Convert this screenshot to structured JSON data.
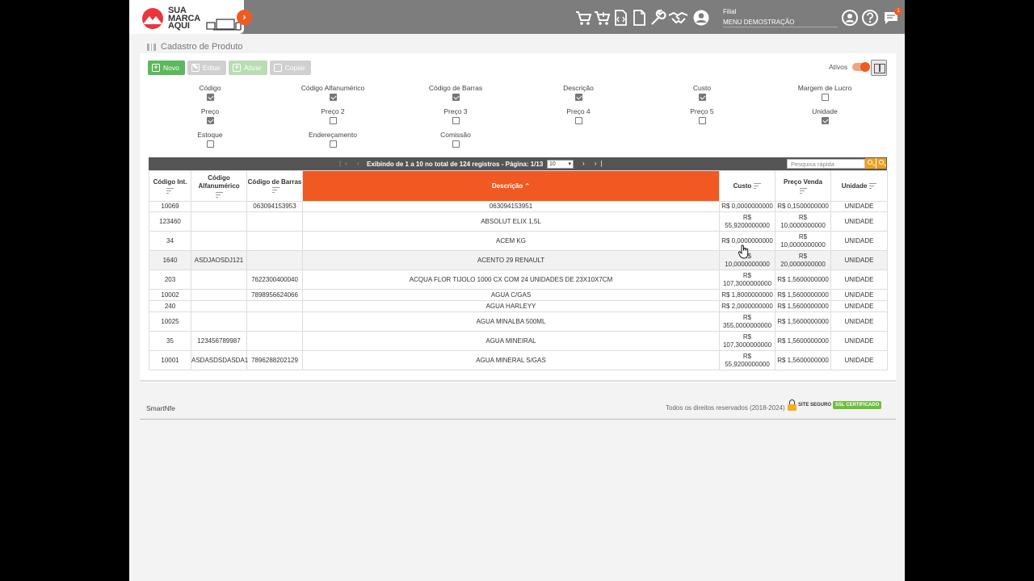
{
  "header": {
    "logo_lines": [
      "SUA",
      "MARCA",
      "AQUI"
    ],
    "icons": [
      "cart-icon",
      "cart-add-icon",
      "code-file-icon",
      "document-icon",
      "wrench-icon",
      "handshake-icon",
      "user-circle-icon"
    ],
    "filial_label": "Filial",
    "filial_value": "MENU DEMOSTRAÇÃO",
    "notification_count": "1"
  },
  "breadcrumb": {
    "title": "Cadastro de Produto"
  },
  "toolbar": {
    "novo": "Novo",
    "editar": "Editar",
    "ativar": "Ativar",
    "copiar": "Copiar",
    "ativos_label": "Ativos"
  },
  "column_options": [
    {
      "label": "Código",
      "checked": true
    },
    {
      "label": "Código Alfanumérico",
      "checked": true
    },
    {
      "label": "Código de Barras",
      "checked": true
    },
    {
      "label": "Descrição",
      "checked": true
    },
    {
      "label": "Custo",
      "checked": true
    },
    {
      "label": "Margem de Lucro",
      "checked": false
    },
    {
      "label": "Preço",
      "checked": true
    },
    {
      "label": "Preço 2",
      "checked": false
    },
    {
      "label": "Preço 3",
      "checked": false
    },
    {
      "label": "Preço 4",
      "checked": false
    },
    {
      "label": "Preço 5",
      "checked": false
    },
    {
      "label": "Unidade",
      "checked": true
    },
    {
      "label": "Estoque",
      "checked": false
    },
    {
      "label": "Endereçamento",
      "checked": false
    },
    {
      "label": "Comissão",
      "checked": false
    }
  ],
  "pager": {
    "text": "Exibindo de 1 a 10 no total de 124 registros - Página: 1/13",
    "page_size": "10",
    "search_placeholder": "Pesquisa rápida"
  },
  "grid": {
    "headers": [
      "Código Int.",
      "Código Alfanumérico",
      "Código de Barras",
      "Descrição",
      "Custo",
      "Preço Venda",
      "Unidade"
    ],
    "rows": [
      [
        "10069",
        "",
        "063094153953",
        "063094153951",
        "R$ 0,0000000000",
        "R$ 0,1500000000",
        "UNIDADE"
      ],
      [
        "123460",
        "",
        "",
        "ABSOLUT ELIX 1,5L",
        "R$ 55,9200000000",
        "R$ 10,0000000000",
        "UNIDADE"
      ],
      [
        "34",
        "",
        "",
        "ACEM KG",
        "R$ 0,0000000000",
        "R$ 10,0000000000",
        "UNIDADE"
      ],
      [
        "1640",
        "ASDJAOSDJ121",
        "",
        "ACENTO 29 RENAULT",
        "R$ 10,0000000000",
        "R$ 20,0000000000",
        "UNIDADE"
      ],
      [
        "203",
        "",
        "7622300400040",
        "ACQUA FLOR TIJOLO 1000 CX COM 24 UNIDADES DE 23X10X7CM",
        "R$ 107,3000000000",
        "R$ 1,5600000000",
        "UNIDADE"
      ],
      [
        "10002",
        "",
        "7898956624066",
        "AGUA C/GAS",
        "R$ 1,8000000000",
        "R$ 1,5600000000",
        "UNIDADE"
      ],
      [
        "240",
        "",
        "",
        "AGUA HARLEYY",
        "R$ 2,0000000000",
        "R$ 1,5600000000",
        "UNIDADE"
      ],
      [
        "10025",
        "",
        "",
        "AGUA MINALBA 500ML",
        "R$ 355,0000000000",
        "R$ 1,5600000000",
        "UNIDADE"
      ],
      [
        "35",
        "123456789987",
        "",
        "AGUA MINEIRAL",
        "R$ 107,3000000000",
        "R$ 1,5600000000",
        "UNIDADE"
      ],
      [
        "10001",
        "ASDASDSDASDA1",
        "7896288202129",
        "AGUA MINERAL S/GAS",
        "R$ 55,9200000000",
        "R$ 1,5600000000",
        "UNIDADE"
      ]
    ]
  },
  "footer": {
    "brand": "SmartNfe",
    "rights": "Todos os direitos reservados (2018-2024)",
    "ssl_text": "SITE SEGURO",
    "ssl_badge": "SSL CERTIFICADO"
  },
  "colors": {
    "accent": "#f05a22",
    "header_bg": "#7d7d7d",
    "success": "#5cb85c"
  }
}
